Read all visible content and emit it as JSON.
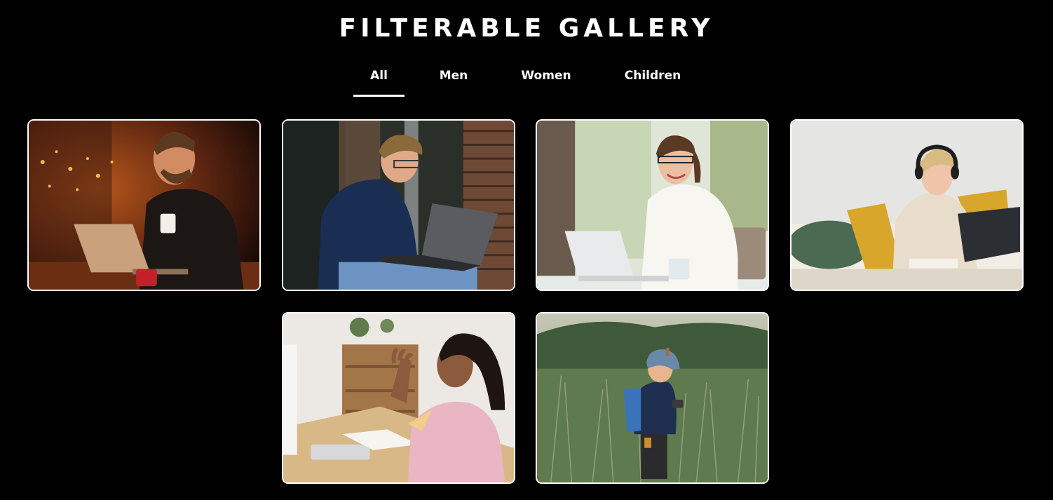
{
  "header": {
    "title": "FILTERABLE GALLERY"
  },
  "filters": {
    "tabs": [
      {
        "label": "All",
        "active": true
      },
      {
        "label": "Men",
        "active": false
      },
      {
        "label": "Women",
        "active": false
      },
      {
        "label": "Children",
        "active": false
      }
    ]
  },
  "gallery": {
    "items": [
      {
        "category": "Men",
        "subject": "man with laptop and coffee at night cafe"
      },
      {
        "category": "Men",
        "subject": "young man with glasses using laptop outdoors"
      },
      {
        "category": "Women",
        "subject": "smiling woman in white blazer at laptop"
      },
      {
        "category": "Women",
        "subject": "woman with headphones using laptop on couch"
      },
      {
        "category": "Children",
        "subject": "girl waving at desk with notebook"
      },
      {
        "category": "Children",
        "subject": "boy with backpack and camera in tall grass"
      }
    ]
  },
  "colors": {
    "background": "#000000",
    "text": "#ffffff",
    "card_border": "#ffffff"
  }
}
